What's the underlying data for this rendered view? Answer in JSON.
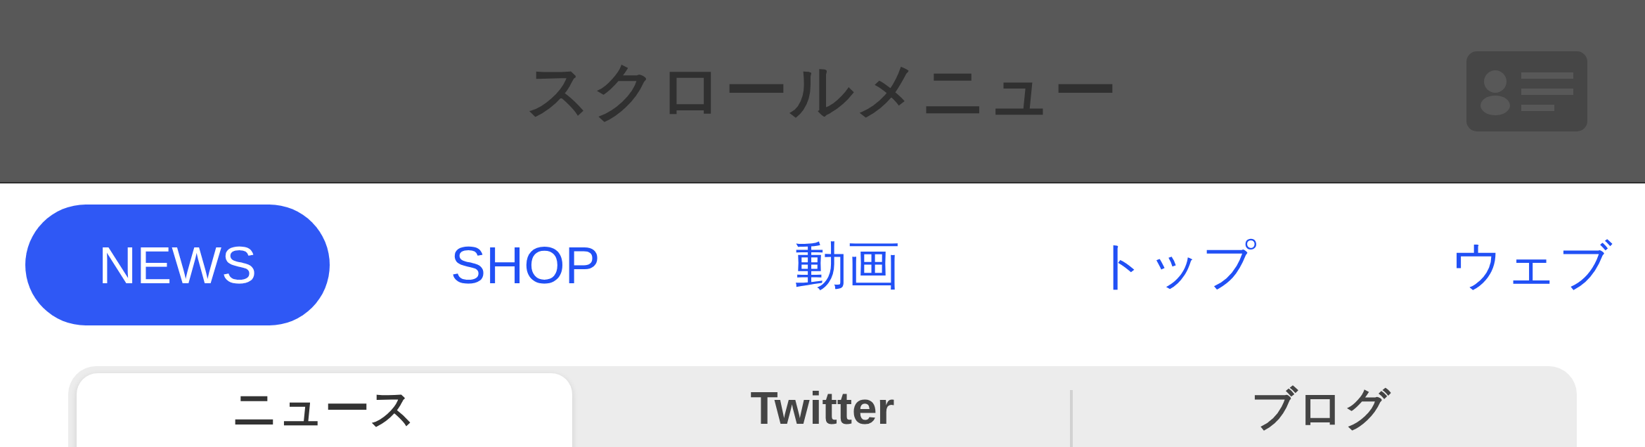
{
  "header": {
    "title": "スクロールメニュー"
  },
  "tabs": [
    {
      "label": "NEWS",
      "selected": true
    },
    {
      "label": "SHOP",
      "selected": false
    },
    {
      "label": "動画",
      "selected": false
    },
    {
      "label": "トップ",
      "selected": false
    },
    {
      "label": "ウェブ",
      "selected": false
    }
  ],
  "segments": [
    {
      "label": "ニュース",
      "selected": true
    },
    {
      "label": "Twitter",
      "selected": false
    },
    {
      "label": "ブログ",
      "selected": false
    }
  ]
}
